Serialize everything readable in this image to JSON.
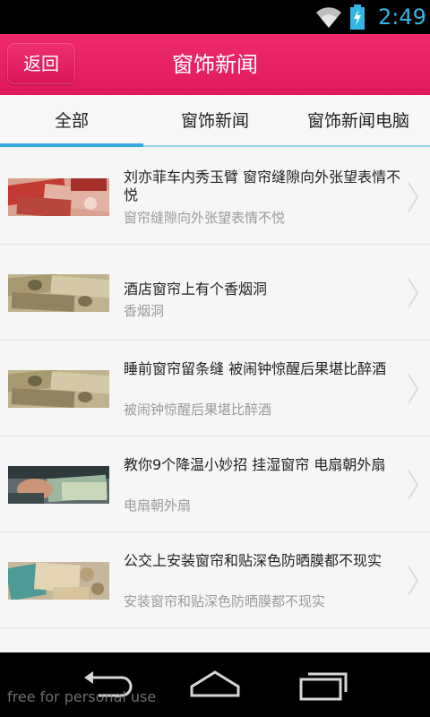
{
  "status_bar": {
    "time": "2:49",
    "icons": [
      "wifi-icon",
      "battery-charging-icon"
    ],
    "accent_color": "#33b5e5"
  },
  "header": {
    "back_label": "返回",
    "title": "窗饰新闻",
    "color": "#e91e63"
  },
  "tabs": [
    {
      "label": "全部",
      "active": true
    },
    {
      "label": "窗饰新闻",
      "active": false
    },
    {
      "label": "窗饰新闻电脑",
      "active": false
    }
  ],
  "tab_indicator_color": "#39a8e0",
  "news": [
    {
      "title": "刘亦菲车内秀玉臂 窗帘缝隙向外张望表情不悦",
      "summary": "窗帘缝隙向外张望表情不悦",
      "thumb": "red-banknotes-image"
    },
    {
      "title": "酒店窗帘上有个香烟洞",
      "summary": "香烟洞",
      "thumb": "dollar-bills-image"
    },
    {
      "title": "睡前窗帘留条缝 被闹钟惊醒后果堪比醉酒",
      "summary": "被闹钟惊醒后果堪比醉酒",
      "thumb": "dollar-bills-image"
    },
    {
      "title": "教你9个降温小妙招 挂湿窗帘 电扇朝外扇",
      "summary": "电扇朝外扇",
      "thumb": "hand-counting-cash-image"
    },
    {
      "title": "公交上安装窗帘和贴深色防晒膜都不现实",
      "summary": "安装窗帘和贴深色防晒膜都不现实",
      "thumb": "cash-and-coins-image"
    }
  ],
  "nav": {
    "buttons": [
      "back-nav-icon",
      "home-nav-icon",
      "recent-apps-icon"
    ]
  },
  "watermark": "free for personal use"
}
